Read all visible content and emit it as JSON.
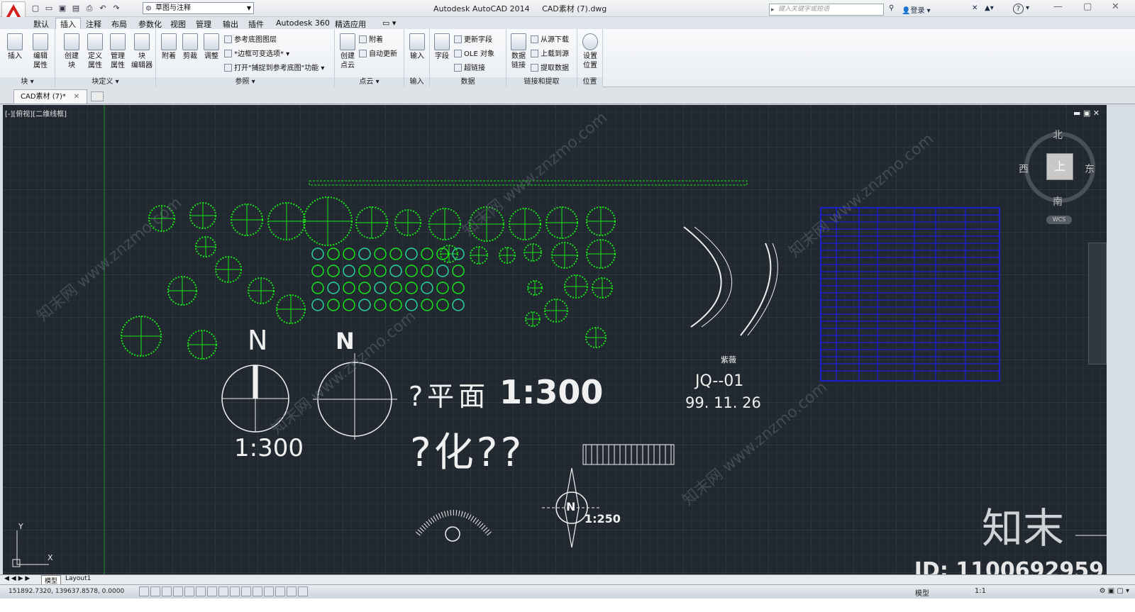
{
  "app": {
    "title": "Autodesk AutoCAD 2014",
    "doc": "CAD素材 (7).dwg",
    "workspace": "草图与注释",
    "search_placeholder": "键入关键字或短语",
    "login": "登录",
    "help": "?"
  },
  "ribbon_tabs": [
    "默认",
    "插入",
    "注释",
    "布局",
    "参数化",
    "视图",
    "管理",
    "输出",
    "插件",
    "Autodesk 360",
    "精选应用"
  ],
  "ribbon_active": "插入",
  "panels": [
    {
      "title": "块 ▾",
      "big": [
        "插入",
        "编辑\n属性"
      ]
    },
    {
      "title": "块定义 ▾",
      "big": [
        "创建\n块",
        "定义\n属性",
        "管理\n属性",
        "块\n编辑器"
      ]
    },
    {
      "title": "参照 ▾",
      "big": [
        "附着",
        "剪裁",
        "调整"
      ],
      "small": [
        "参考底图图层",
        "*边框可变选项* ▾",
        "打开\"捕捉到参考底图\"功能 ▾"
      ]
    },
    {
      "title": "点云 ▾",
      "big": [
        "创建\n点云"
      ],
      "small": [
        "附着",
        "自动更新"
      ]
    },
    {
      "title": "输入",
      "big": [
        "输入"
      ]
    },
    {
      "title": "数据",
      "big": [
        "字段"
      ],
      "small": [
        "更新字段",
        "OLE 对象",
        "超链接"
      ]
    },
    {
      "title": "链接和提取",
      "big": [
        "数据\n链接"
      ],
      "small": [
        "从源下载",
        "上载到源",
        "提取数据"
      ]
    },
    {
      "title": "位置",
      "big": [
        "设置\n位置"
      ]
    }
  ],
  "doc_tab": "CAD素材 (7)*",
  "viewport_label": "[-][俯视][二维线框]",
  "viewcube": {
    "top": "上",
    "north": "北",
    "south": "南",
    "east": "东",
    "west": "西",
    "wcs": "WCS"
  },
  "drawing": {
    "north1_letter": "N",
    "north1_scale": "1:300",
    "north2_letter": "N",
    "plan_title": "?平面",
    "plan_scale": "1:300",
    "green_title": "?化??",
    "label_ziwei": "紫薇",
    "label_jq": "JQ--01",
    "label_date": "99. 11. 26",
    "compass_scale": "1:250",
    "compass_letter": "N"
  },
  "watermarks": [
    "知末网 www.znzmo.com"
  ],
  "brand": "知末",
  "id_text": "ID: 1100692959",
  "layout_tabs": [
    "模型",
    "Layout1"
  ],
  "status": {
    "coords": "151892.7320, 139637.8578, 0.0000",
    "model": "模型",
    "scale": "1:1"
  },
  "colors": {
    "canvas": "#212830",
    "plant_green": "#19e619",
    "table_blue": "#1a1aff",
    "white_lines": "#f0f0f0"
  }
}
